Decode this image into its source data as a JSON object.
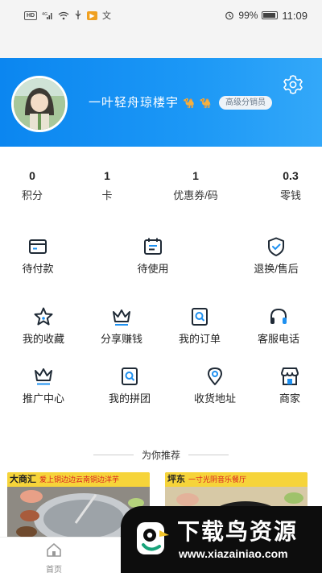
{
  "status_bar": {
    "left_icons": [
      "HD",
      "4G",
      "wifi",
      "usb",
      "play",
      "文"
    ],
    "battery": "99%",
    "time": "11:09"
  },
  "profile": {
    "name": "一叶轻舟琼楼宇",
    "name_emoji": "🐪 🐪",
    "badge": "高级分销员"
  },
  "stats": [
    {
      "value": "0",
      "label": "积分"
    },
    {
      "value": "1",
      "label": "卡"
    },
    {
      "value": "1",
      "label": "优惠券/码"
    },
    {
      "value": "0.3",
      "label": "零钱"
    }
  ],
  "orders": [
    {
      "icon": "wallet-card-icon",
      "label": "待付款"
    },
    {
      "icon": "calendar-list-icon",
      "label": "待使用"
    },
    {
      "icon": "shield-check-icon",
      "label": "退换/售后"
    }
  ],
  "services_row1": [
    {
      "icon": "star-icon",
      "label": "我的收藏"
    },
    {
      "icon": "crown-icon",
      "label": "分享赚钱"
    },
    {
      "icon": "search-order-icon",
      "label": "我的订单"
    },
    {
      "icon": "headset-icon",
      "label": "客服电话"
    }
  ],
  "services_row2": [
    {
      "icon": "promo-crown-icon",
      "label": "推广中心"
    },
    {
      "icon": "group-search-icon",
      "label": "我的拼团"
    },
    {
      "icon": "location-pin-icon",
      "label": "收货地址"
    },
    {
      "icon": "shop-icon",
      "label": "商家"
    }
  ],
  "recommend": {
    "title": "为你推荐",
    "products": [
      {
        "banner": "大商汇",
        "sub": "爱上铜边边云南铜边洋芋"
      },
      {
        "banner": "坪东",
        "sub": "一寸光阴音乐餐厅"
      }
    ]
  },
  "tabbar": {
    "home": "首页"
  },
  "watermark": {
    "title": "下载鸟资源",
    "url": "www.xiazainiao.com"
  },
  "colors": {
    "header_blue": "#0b86f0",
    "icon_dark": "#1f2a36",
    "accent_blue": "#1e90f0"
  }
}
